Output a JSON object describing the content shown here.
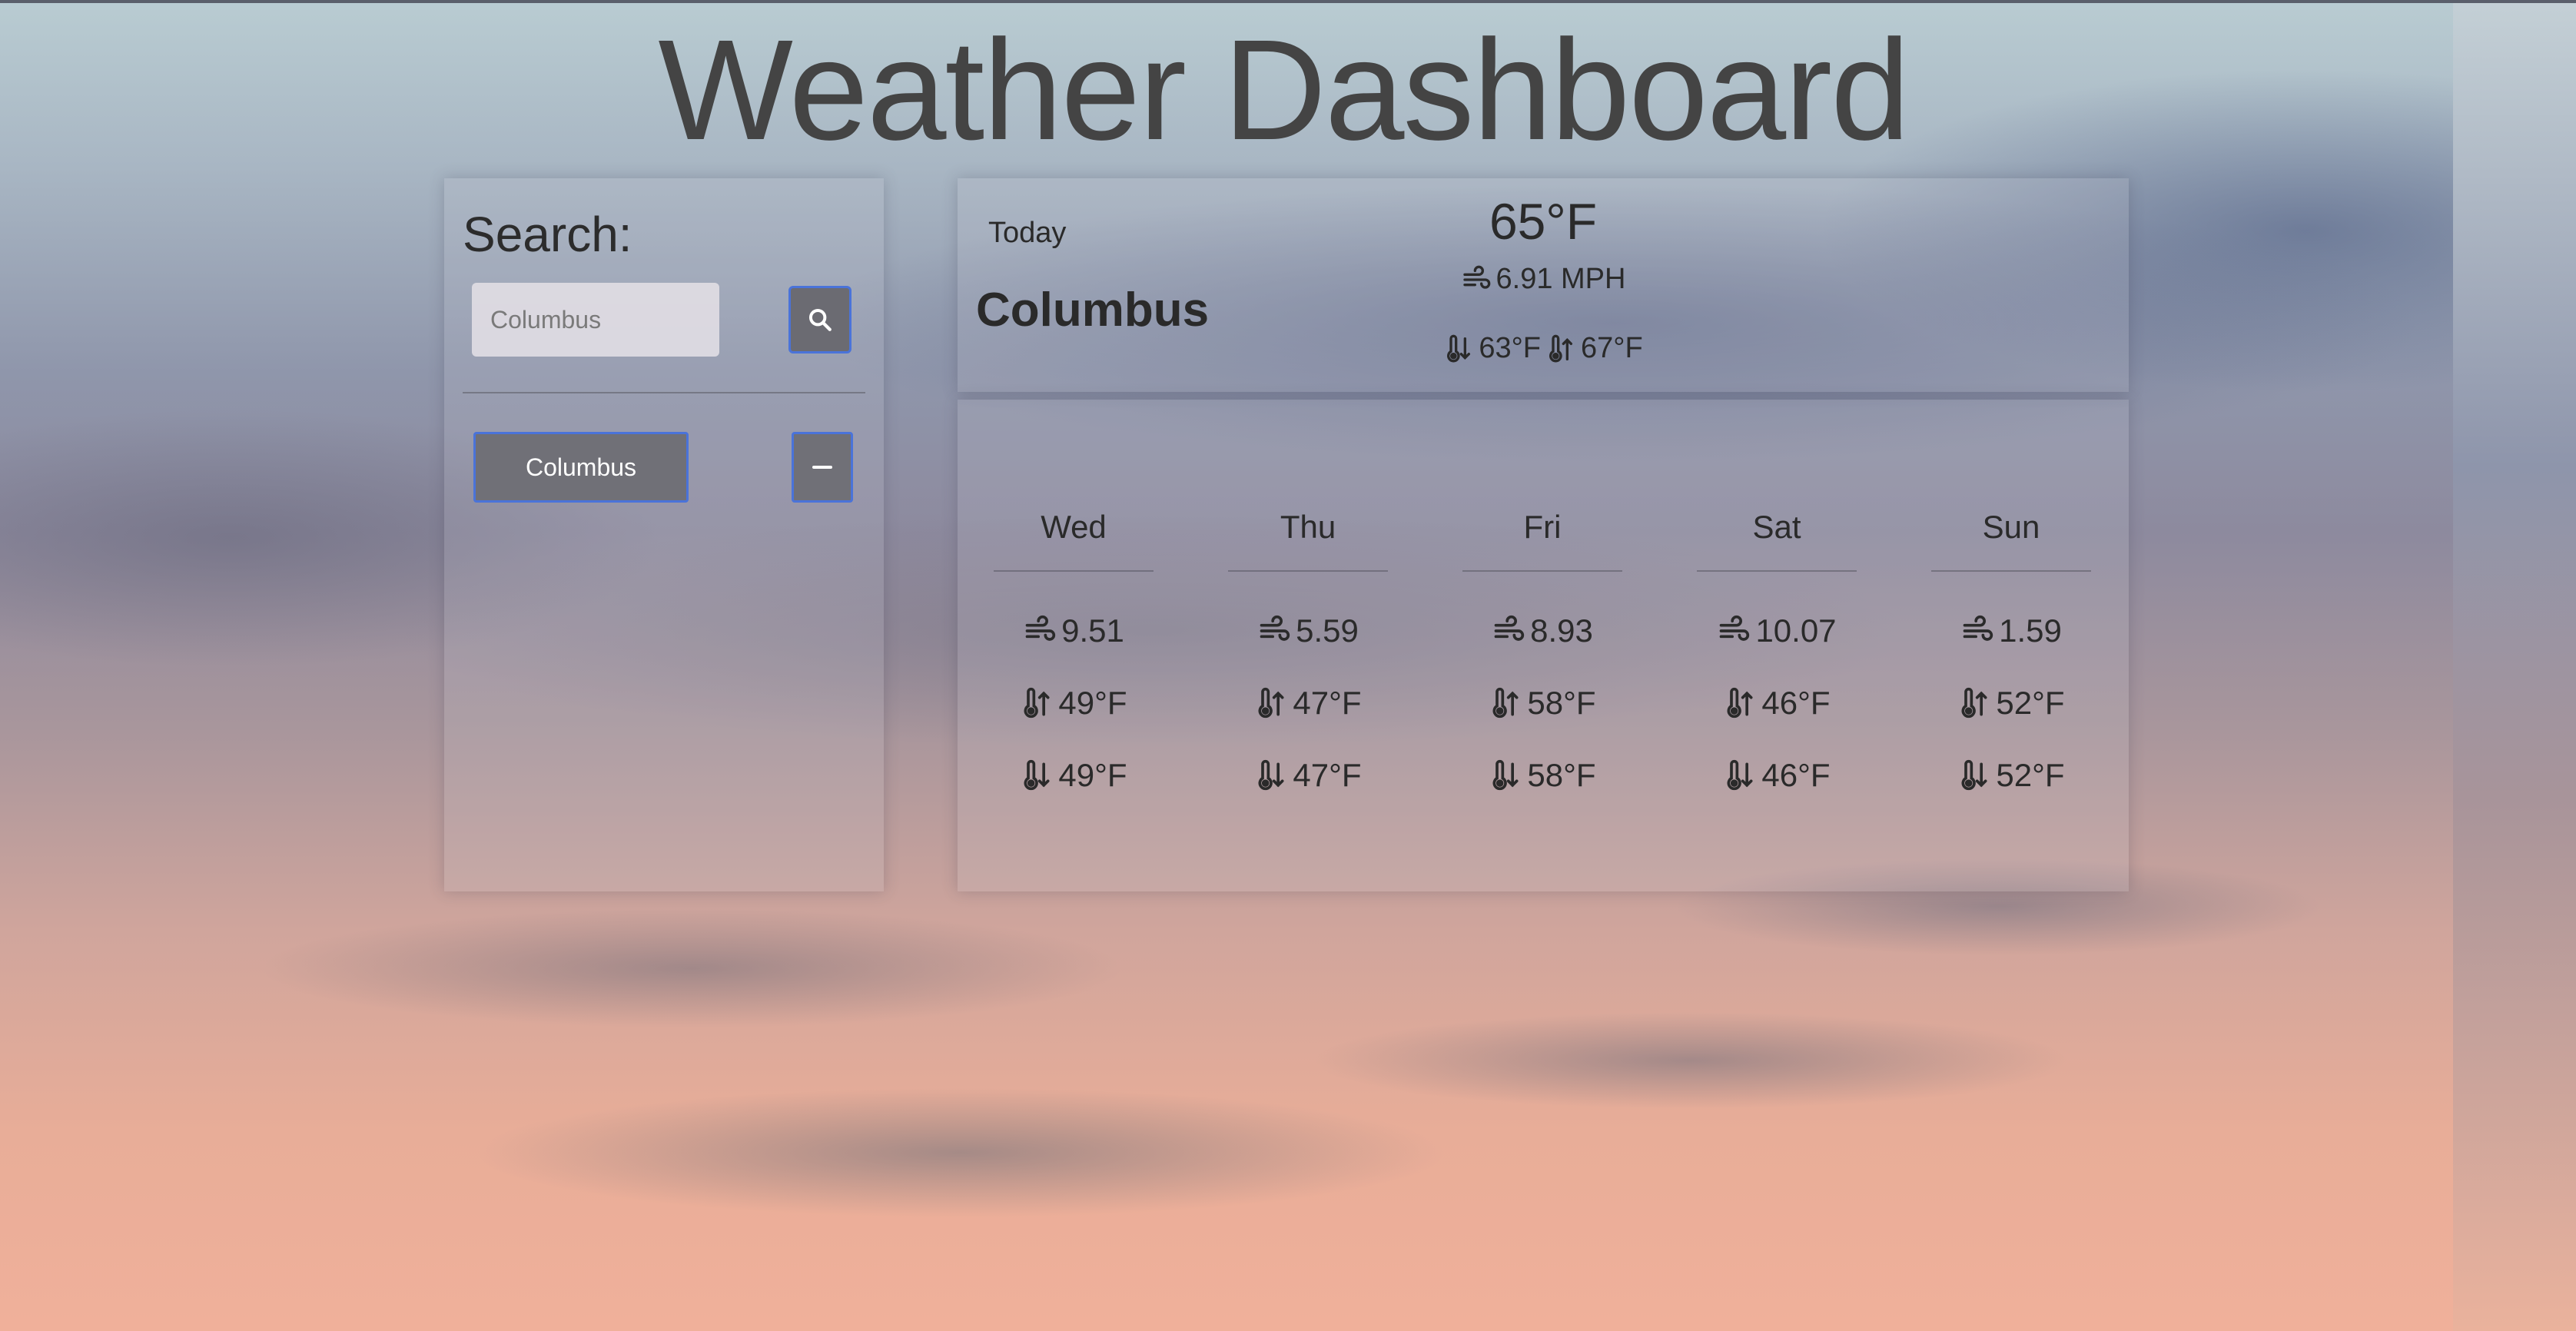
{
  "header": {
    "title": "Weather Dashboard"
  },
  "search": {
    "title": "Search:",
    "placeholder": "Columbus",
    "value": "",
    "button_icon": "search-icon",
    "history": [
      {
        "label": "Columbus",
        "remove_icon": "minus-icon"
      }
    ]
  },
  "today": {
    "label": "Today",
    "city": "Columbus",
    "temp": "65°F",
    "wind": "6.91 MPH",
    "low": "63°F",
    "high": "67°F",
    "wind_icon": "wind-icon",
    "low_icon": "thermometer-low-icon",
    "high_icon": "thermometer-high-icon"
  },
  "forecast": {
    "days": [
      {
        "name": "Wed",
        "wind": "9.51",
        "high": "49°F",
        "low": "49°F"
      },
      {
        "name": "Thu",
        "wind": "5.59",
        "high": "47°F",
        "low": "47°F"
      },
      {
        "name": "Fri",
        "wind": "8.93",
        "high": "58°F",
        "low": "58°F"
      },
      {
        "name": "Sat",
        "wind": "10.07",
        "high": "46°F",
        "low": "46°F"
      },
      {
        "name": "Sun",
        "wind": "1.59",
        "high": "52°F",
        "low": "52°F"
      }
    ]
  },
  "colors": {
    "accent_border": "#4a73d9",
    "button_bg": "#707077",
    "title_text": "#444444"
  }
}
